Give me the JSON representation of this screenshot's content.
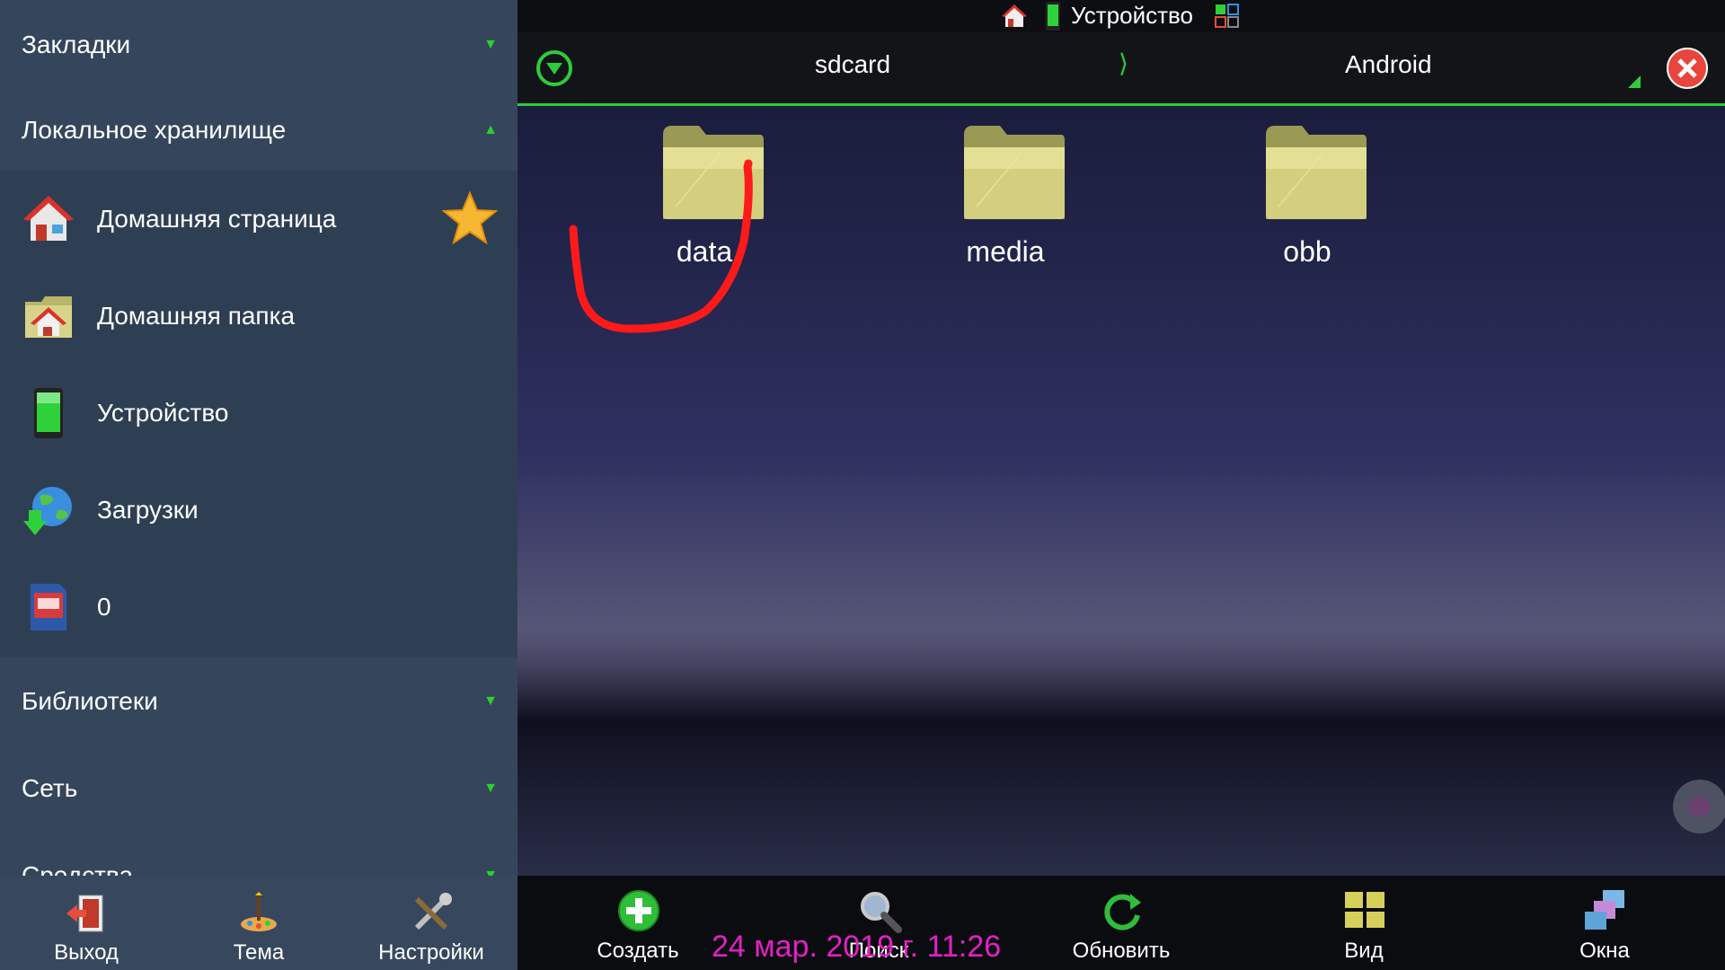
{
  "sidebar": {
    "bookmarks": "Закладки",
    "local_storage": "Локальное хранилище",
    "items": [
      {
        "label": "Домашняя страница",
        "icon": "home-icon"
      },
      {
        "label": "Домашняя папка",
        "icon": "home-folder-icon"
      },
      {
        "label": "Устройство",
        "icon": "phone-icon"
      },
      {
        "label": "Загрузки",
        "icon": "globe-download-icon"
      },
      {
        "label": "0",
        "icon": "sdcard-icon"
      }
    ],
    "libraries": "Библиотеки",
    "network": "Сеть",
    "tools": "Средства",
    "bottom": {
      "exit": "Выход",
      "theme": "Тема",
      "settings": "Настройки"
    }
  },
  "titlebar": {
    "title": "Устройство"
  },
  "pathbar": {
    "crumb1": "sdcard",
    "separator": "⟩",
    "crumb2": "Android"
  },
  "folders": [
    "data",
    "media",
    "obb"
  ],
  "toolbar": {
    "create": "Создать",
    "search": "Поиск",
    "refresh": "Обновить",
    "view": "Вид",
    "windows": "Окна"
  },
  "datetime": "24 мар. 2019 г. 11:26",
  "colors": {
    "accent": "#2ecc3a",
    "sidebar_bg": "#35465c",
    "annotation": "#ff1a1a",
    "datetime": "#e321c4"
  }
}
